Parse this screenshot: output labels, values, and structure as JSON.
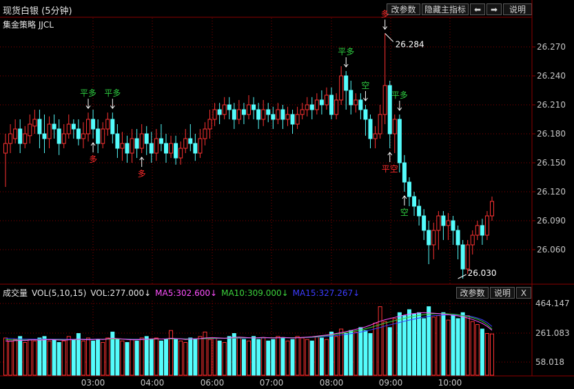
{
  "header": {
    "title": "现货白银 (5分钟)",
    "strategy": "集金策略 JJCL",
    "buttons": {
      "params": "改参数",
      "hide_main": "隐藏主指标",
      "left": "⬅",
      "right": "➡",
      "help": "说明"
    }
  },
  "volume_header": {
    "name": "成交量",
    "indicator": "VOL(5,10,15)",
    "vol": "VOL:277.000↓",
    "ma5": "MA5:302.600↓",
    "ma10": "MA10:309.000↓",
    "ma15": "MA15:327.267↓",
    "buttons": {
      "params": "改参数",
      "help": "说明",
      "close": "X"
    }
  },
  "colors": {
    "up": "#ff3232",
    "down": "#54fcfc",
    "ma5": "#ff50ff",
    "ma10": "#3cd23c",
    "ma15": "#3c3cff",
    "grid": "#8b0000",
    "signal_buy": "#ff2a2a",
    "signal_close": "#2ecc40"
  },
  "chart_data": {
    "type": "candlestick",
    "price_axis": {
      "ticks": [
        "26.270",
        "26.240",
        "26.210",
        "26.180",
        "26.150",
        "26.120",
        "26.090",
        "26.060"
      ],
      "ylim": [
        26.025,
        26.3
      ]
    },
    "volume_axis": {
      "ticks": [
        "464.147",
        "261.083",
        "58.018"
      ],
      "ylim": [
        0,
        500
      ]
    },
    "time_labels": [
      "03:00",
      "04:00",
      "06:00",
      "07:00",
      "08:00",
      "09:00",
      "10:00"
    ],
    "high_label": "26.284",
    "low_label": "26.030",
    "candles": [
      [
        26.16,
        26.17,
        26.125,
        26.18
      ],
      [
        26.17,
        26.18,
        26.16,
        26.19
      ],
      [
        26.175,
        26.185,
        26.17,
        26.195
      ],
      [
        26.185,
        26.17,
        26.16,
        26.195
      ],
      [
        26.17,
        26.18,
        26.165,
        26.188
      ],
      [
        26.178,
        26.19,
        26.17,
        26.2
      ],
      [
        26.188,
        26.195,
        26.18,
        26.205
      ],
      [
        26.195,
        26.18,
        26.165,
        26.205
      ],
      [
        26.18,
        26.175,
        26.16,
        26.2
      ],
      [
        26.175,
        26.19,
        26.165,
        26.198
      ],
      [
        26.19,
        26.185,
        26.175,
        26.2
      ],
      [
        26.185,
        26.17,
        26.158,
        26.195
      ],
      [
        26.17,
        26.18,
        26.165,
        26.19
      ],
      [
        26.18,
        26.19,
        26.175,
        26.2
      ],
      [
        26.19,
        26.185,
        26.175,
        26.195
      ],
      [
        26.185,
        26.175,
        26.168,
        26.195
      ],
      [
        26.175,
        26.18,
        26.165,
        26.192
      ],
      [
        26.18,
        26.195,
        26.172,
        26.202
      ],
      [
        26.195,
        26.185,
        26.175,
        26.205
      ],
      [
        26.185,
        26.17,
        26.16,
        26.195
      ],
      [
        26.17,
        26.185,
        26.165,
        26.192
      ],
      [
        26.185,
        26.195,
        26.178,
        26.202
      ],
      [
        26.195,
        26.18,
        26.17,
        26.202
      ],
      [
        26.18,
        26.165,
        26.155,
        26.19
      ],
      [
        26.165,
        26.17,
        26.152,
        26.182
      ],
      [
        26.17,
        26.16,
        26.15,
        26.178
      ],
      [
        26.16,
        26.175,
        26.15,
        26.185
      ],
      [
        26.175,
        26.165,
        26.155,
        26.185
      ],
      [
        26.165,
        26.18,
        26.16,
        26.19
      ],
      [
        26.18,
        26.17,
        26.158,
        26.188
      ],
      [
        26.17,
        26.16,
        26.15,
        26.182
      ],
      [
        26.16,
        26.175,
        26.152,
        26.185
      ],
      [
        26.175,
        26.17,
        26.162,
        26.19
      ],
      [
        26.17,
        26.16,
        26.15,
        26.18
      ],
      [
        26.16,
        26.17,
        26.155,
        26.178
      ],
      [
        26.17,
        26.155,
        26.148,
        26.178
      ],
      [
        26.155,
        26.165,
        26.148,
        26.172
      ],
      [
        26.165,
        26.175,
        26.16,
        26.185
      ],
      [
        26.175,
        26.17,
        26.162,
        26.19
      ],
      [
        26.17,
        26.16,
        26.152,
        26.18
      ],
      [
        26.16,
        26.175,
        26.155,
        26.185
      ],
      [
        26.175,
        26.185,
        26.168,
        26.192
      ],
      [
        26.185,
        26.195,
        26.175,
        26.205
      ],
      [
        26.195,
        26.205,
        26.188,
        26.212
      ],
      [
        26.205,
        26.2,
        26.19,
        26.212
      ],
      [
        26.2,
        26.21,
        26.195,
        26.218
      ],
      [
        26.21,
        26.205,
        26.195,
        26.218
      ],
      [
        26.205,
        26.195,
        26.185,
        26.212
      ],
      [
        26.195,
        26.205,
        26.19,
        26.215
      ],
      [
        26.205,
        26.2,
        26.19,
        26.212
      ],
      [
        26.2,
        26.21,
        26.195,
        26.22
      ],
      [
        26.21,
        26.205,
        26.195,
        26.218
      ],
      [
        26.205,
        26.195,
        26.185,
        26.212
      ],
      [
        26.195,
        26.205,
        26.188,
        26.215
      ],
      [
        26.205,
        26.2,
        26.192,
        26.212
      ],
      [
        26.2,
        26.195,
        26.185,
        26.208
      ],
      [
        26.195,
        26.205,
        26.19,
        26.212
      ],
      [
        26.205,
        26.195,
        26.185,
        26.21
      ],
      [
        26.195,
        26.2,
        26.188,
        26.208
      ],
      [
        26.2,
        26.19,
        26.18,
        26.205
      ],
      [
        26.19,
        26.2,
        26.185,
        26.208
      ],
      [
        26.2,
        26.205,
        26.195,
        26.212
      ],
      [
        26.205,
        26.21,
        26.198,
        26.218
      ],
      [
        26.21,
        26.205,
        26.195,
        26.218
      ],
      [
        26.205,
        26.215,
        26.2,
        26.222
      ],
      [
        26.215,
        26.21,
        26.2,
        26.225
      ],
      [
        26.21,
        26.22,
        26.205,
        26.228
      ],
      [
        26.22,
        26.2,
        26.195,
        26.228
      ],
      [
        26.2,
        26.215,
        26.195,
        26.222
      ],
      [
        26.215,
        26.24,
        26.21,
        26.25
      ],
      [
        26.24,
        26.225,
        26.205,
        26.245
      ],
      [
        26.225,
        26.21,
        26.2,
        26.235
      ],
      [
        26.21,
        26.215,
        26.202,
        26.222
      ],
      [
        26.215,
        26.205,
        26.195,
        26.222
      ],
      [
        26.205,
        26.195,
        26.178,
        26.21
      ],
      [
        26.195,
        26.175,
        26.165,
        26.2
      ],
      [
        26.175,
        26.18,
        26.165,
        26.188
      ],
      [
        26.18,
        26.2,
        26.175,
        26.21
      ],
      [
        26.2,
        26.23,
        26.19,
        26.284
      ],
      [
        26.23,
        26.18,
        26.165,
        26.235
      ],
      [
        26.18,
        26.195,
        26.16,
        26.2
      ],
      [
        26.195,
        26.15,
        26.14,
        26.2
      ],
      [
        26.15,
        26.13,
        26.12,
        26.158
      ],
      [
        26.13,
        26.115,
        26.105,
        26.135
      ],
      [
        26.115,
        26.105,
        26.095,
        26.12
      ],
      [
        26.105,
        26.095,
        26.085,
        26.112
      ],
      [
        26.095,
        26.08,
        26.07,
        26.102
      ],
      [
        26.08,
        26.065,
        26.045,
        26.09
      ],
      [
        26.065,
        26.08,
        26.05,
        26.088
      ],
      [
        26.08,
        26.095,
        26.06,
        26.1
      ],
      [
        26.095,
        26.085,
        26.07,
        26.1
      ],
      [
        26.085,
        26.09,
        26.07,
        26.098
      ],
      [
        26.09,
        26.08,
        26.065,
        26.095
      ],
      [
        26.08,
        26.065,
        26.05,
        26.085
      ],
      [
        26.065,
        26.04,
        26.03,
        26.07
      ],
      [
        26.04,
        26.065,
        26.035,
        26.07
      ],
      [
        26.065,
        26.075,
        26.055,
        26.08
      ],
      [
        26.075,
        26.085,
        26.07,
        26.09
      ],
      [
        26.085,
        26.075,
        26.065,
        26.092
      ],
      [
        26.075,
        26.095,
        26.07,
        26.1
      ],
      [
        26.095,
        26.11,
        26.09,
        26.115
      ]
    ],
    "volume": [
      250,
      230,
      240,
      260,
      220,
      240,
      230,
      250,
      260,
      230,
      240,
      220,
      230,
      260,
      240,
      280,
      230,
      250,
      230,
      240,
      220,
      250,
      290,
      240,
      230,
      220,
      240,
      230,
      250,
      260,
      240,
      250,
      230,
      240,
      300,
      240,
      230,
      220,
      250,
      240,
      260,
      290,
      240,
      250,
      230,
      220,
      260,
      280,
      250,
      240,
      230,
      260,
      240,
      250,
      230,
      240,
      260,
      250,
      230,
      240,
      260,
      250,
      240,
      230,
      260,
      250,
      240,
      290,
      260,
      310,
      280,
      300,
      290,
      320,
      300,
      280,
      350,
      460,
      360,
      320,
      380,
      420,
      400,
      440,
      410,
      420,
      380,
      460,
      390,
      400,
      420,
      370,
      400,
      380,
      420,
      400,
      360,
      340,
      310,
      280,
      277
    ],
    "ma5_line": [
      230,
      228,
      232,
      234,
      233,
      236,
      238,
      235,
      238,
      240,
      238,
      236,
      235,
      238,
      240,
      242,
      240,
      238,
      240,
      242,
      240,
      244,
      248,
      246,
      243,
      240,
      238,
      238,
      240,
      242,
      244,
      245,
      243,
      244,
      248,
      246,
      244,
      240,
      242,
      244,
      246,
      250,
      252,
      252,
      250,
      248,
      250,
      254,
      256,
      254,
      252,
      250,
      252,
      254,
      252,
      250,
      252,
      254,
      252,
      250,
      252,
      254,
      256,
      258,
      262,
      266,
      270,
      274,
      280,
      286,
      292,
      300,
      308,
      316,
      324,
      336,
      350,
      362,
      372,
      380,
      388,
      396,
      404,
      410,
      414,
      418,
      420,
      418,
      416,
      414,
      410,
      406,
      402,
      398,
      392,
      384,
      374,
      362,
      348,
      328,
      302
    ],
    "ma10_line": [
      240,
      238,
      236,
      236,
      236,
      237,
      238,
      238,
      239,
      240,
      240,
      239,
      238,
      238,
      239,
      240,
      240,
      240,
      240,
      241,
      241,
      242,
      243,
      243,
      242,
      241,
      240,
      240,
      240,
      241,
      242,
      243,
      243,
      243,
      244,
      244,
      244,
      243,
      243,
      244,
      245,
      246,
      247,
      248,
      248,
      248,
      249,
      250,
      251,
      251,
      251,
      251,
      251,
      252,
      252,
      252,
      252,
      252,
      252,
      252,
      252,
      253,
      254,
      256,
      258,
      262,
      266,
      270,
      275,
      280,
      286,
      292,
      298,
      304,
      312,
      320,
      330,
      340,
      350,
      358,
      366,
      374,
      382,
      390,
      396,
      402,
      406,
      410,
      412,
      413,
      413,
      412,
      410,
      406,
      400,
      394,
      386,
      376,
      362,
      340,
      309
    ],
    "ma15_line": [
      248,
      246,
      244,
      243,
      242,
      242,
      242,
      242,
      242,
      242,
      242,
      242,
      241,
      241,
      241,
      242,
      242,
      242,
      242,
      242,
      242,
      243,
      243,
      243,
      243,
      243,
      242,
      242,
      242,
      242,
      243,
      243,
      243,
      244,
      244,
      244,
      244,
      244,
      244,
      244,
      245,
      245,
      246,
      246,
      247,
      247,
      248,
      248,
      249,
      249,
      250,
      250,
      250,
      250,
      251,
      251,
      251,
      251,
      251,
      252,
      252,
      252,
      253,
      254,
      256,
      258,
      260,
      263,
      266,
      270,
      274,
      279,
      284,
      290,
      296,
      304,
      312,
      320,
      330,
      338,
      346,
      354,
      362,
      370,
      377,
      384,
      390,
      395,
      399,
      402,
      404,
      405,
      405,
      404,
      402,
      398,
      392,
      384,
      372,
      354,
      327
    ],
    "signals": [
      {
        "label": "平多",
        "index": 17,
        "kind": "close",
        "side": "top"
      },
      {
        "label": "平多",
        "index": 22,
        "kind": "close",
        "side": "top"
      },
      {
        "label": "多",
        "index": 18,
        "kind": "buy",
        "side": "bottom"
      },
      {
        "label": "多",
        "index": 28,
        "kind": "buy",
        "side": "bottom"
      },
      {
        "label": "平多",
        "index": 70,
        "kind": "close",
        "side": "top"
      },
      {
        "label": "空",
        "index": 74,
        "kind": "close",
        "side": "top"
      },
      {
        "label": "多",
        "index": 78,
        "kind": "buy",
        "side": "top"
      },
      {
        "label": "平空",
        "index": 79,
        "kind": "buy",
        "side": "bottom"
      },
      {
        "label": "平多",
        "index": 81,
        "kind": "close",
        "side": "top"
      },
      {
        "label": "空",
        "index": 82,
        "kind": "close",
        "side": "bottom"
      }
    ]
  }
}
